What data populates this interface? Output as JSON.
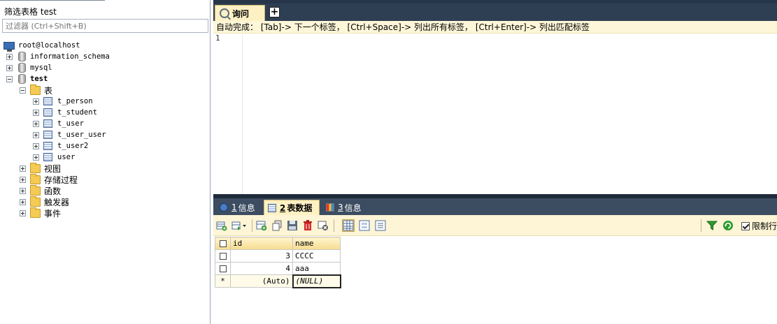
{
  "left_panel": {
    "filter_title": "筛选表格 test",
    "filter_placeholder": "过滤器 (Ctrl+Shift+B)",
    "tree": {
      "connection": "root@localhost",
      "databases": [
        {
          "name": "information_schema"
        },
        {
          "name": "mysql"
        },
        {
          "name": "test"
        }
      ],
      "test_folders": {
        "tables_label": "表",
        "tables": [
          "t_person",
          "t_student",
          "t_user",
          "t_user_user",
          "t_user2",
          "user"
        ],
        "views_label": "视图",
        "procedures_label": "存储过程",
        "functions_label": "函数",
        "triggers_label": "触发器",
        "events_label": "事件"
      }
    }
  },
  "query": {
    "tab_label": "询问",
    "add_tab_label": "+",
    "autocomplete_hint": "自动完成： [Tab]-> 下一个标签， [Ctrl+Space]-> 列出所有标签， [Ctrl+Enter]-> 列出匹配标签",
    "line_number": "1"
  },
  "result_tabs": [
    {
      "num": "1",
      "label": "信息"
    },
    {
      "num": "2",
      "label": "表数据"
    },
    {
      "num": "3",
      "label": "信息"
    }
  ],
  "toolbar": {
    "limit_label": "限制行"
  },
  "results": {
    "columns": [
      "id",
      "name"
    ],
    "rows": [
      {
        "id": "3",
        "name": "CCCC"
      },
      {
        "id": "4",
        "name": "aaa"
      }
    ],
    "new_row": {
      "marker": "*",
      "id": "(Auto)",
      "name": "(NULL)"
    }
  }
}
